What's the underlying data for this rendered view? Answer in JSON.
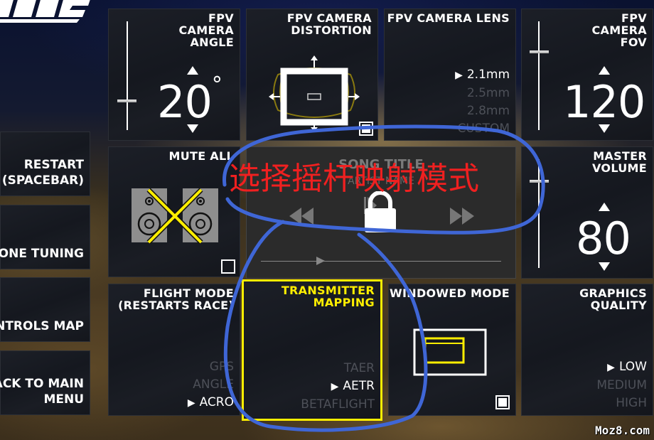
{
  "screen": "settings-menu",
  "side_menu": {
    "items": [
      {
        "label_lines": [
          "RESTART",
          "(SPACEBAR)"
        ]
      },
      {
        "label_lines": [
          "ONE TUNING"
        ]
      },
      {
        "label_lines": [
          "NTROLS MAP"
        ]
      },
      {
        "label_lines": [
          "ACK TO MAIN",
          "MENU"
        ]
      }
    ]
  },
  "tiles": {
    "camera_angle": {
      "title_lines": [
        "FPV",
        "CAMERA",
        "ANGLE"
      ],
      "value": "20",
      "unit": "°",
      "slider_fraction": 0.27
    },
    "camera_distortion": {
      "title_lines": [
        "FPV CAMERA",
        "DISTORTION"
      ],
      "checkbox_checked": true
    },
    "camera_lens": {
      "title": "FPV CAMERA LENS",
      "options": [
        {
          "label": "2.1mm",
          "selected": true
        },
        {
          "label": "2.5mm",
          "selected": false
        },
        {
          "label": "2.8mm",
          "selected": false
        },
        {
          "label": "CUSTOM",
          "selected": false
        }
      ]
    },
    "camera_fov": {
      "title_lines": [
        "FPV",
        "CAMERA",
        "FOV"
      ],
      "value": "120",
      "slider_fraction": 0.72
    },
    "mute_all": {
      "title": "MUTE ALL",
      "checkbox_checked": false
    },
    "music_player": {
      "song_title": "SONG TITLE",
      "artist_name": "ARTIST NAME",
      "locked": true
    },
    "master_volume": {
      "title_lines": [
        "MASTER",
        "VOLUME"
      ],
      "value": "80",
      "slider_fraction": 0.8
    },
    "flight_mode": {
      "title_lines": [
        "FLIGHT MODE",
        "(RESTARTS RACE)"
      ],
      "options": [
        {
          "label": "GPS",
          "selected": false
        },
        {
          "label": "ANGLE",
          "selected": false
        },
        {
          "label": "ACRO",
          "selected": true
        }
      ]
    },
    "transmitter_mapping": {
      "title_lines": [
        "TRANSMITTER",
        "MAPPING"
      ],
      "focused": true,
      "options": [
        {
          "label": "TAER",
          "selected": false
        },
        {
          "label": "AETR",
          "selected": true
        },
        {
          "label": "BETAFLIGHT",
          "selected": false
        }
      ]
    },
    "windowed_mode": {
      "title": "WINDOWED MODE",
      "checkbox_checked": true
    },
    "graphics_quality": {
      "title_lines": [
        "GRAPHICS",
        "QUALITY"
      ],
      "options": [
        {
          "label": "LOW",
          "selected": true
        },
        {
          "label": "MEDIUM",
          "selected": false
        },
        {
          "label": "HIGH",
          "selected": false
        }
      ]
    }
  },
  "select_arrow": "▶",
  "annotation": {
    "text": "选择摇杆映射模式",
    "color": "#f02020",
    "outline_color": "#3f66d6"
  },
  "colors": {
    "accent_yellow": "#ffee00",
    "text_dim": "#4d5058"
  },
  "watermark": "Moz8.com"
}
